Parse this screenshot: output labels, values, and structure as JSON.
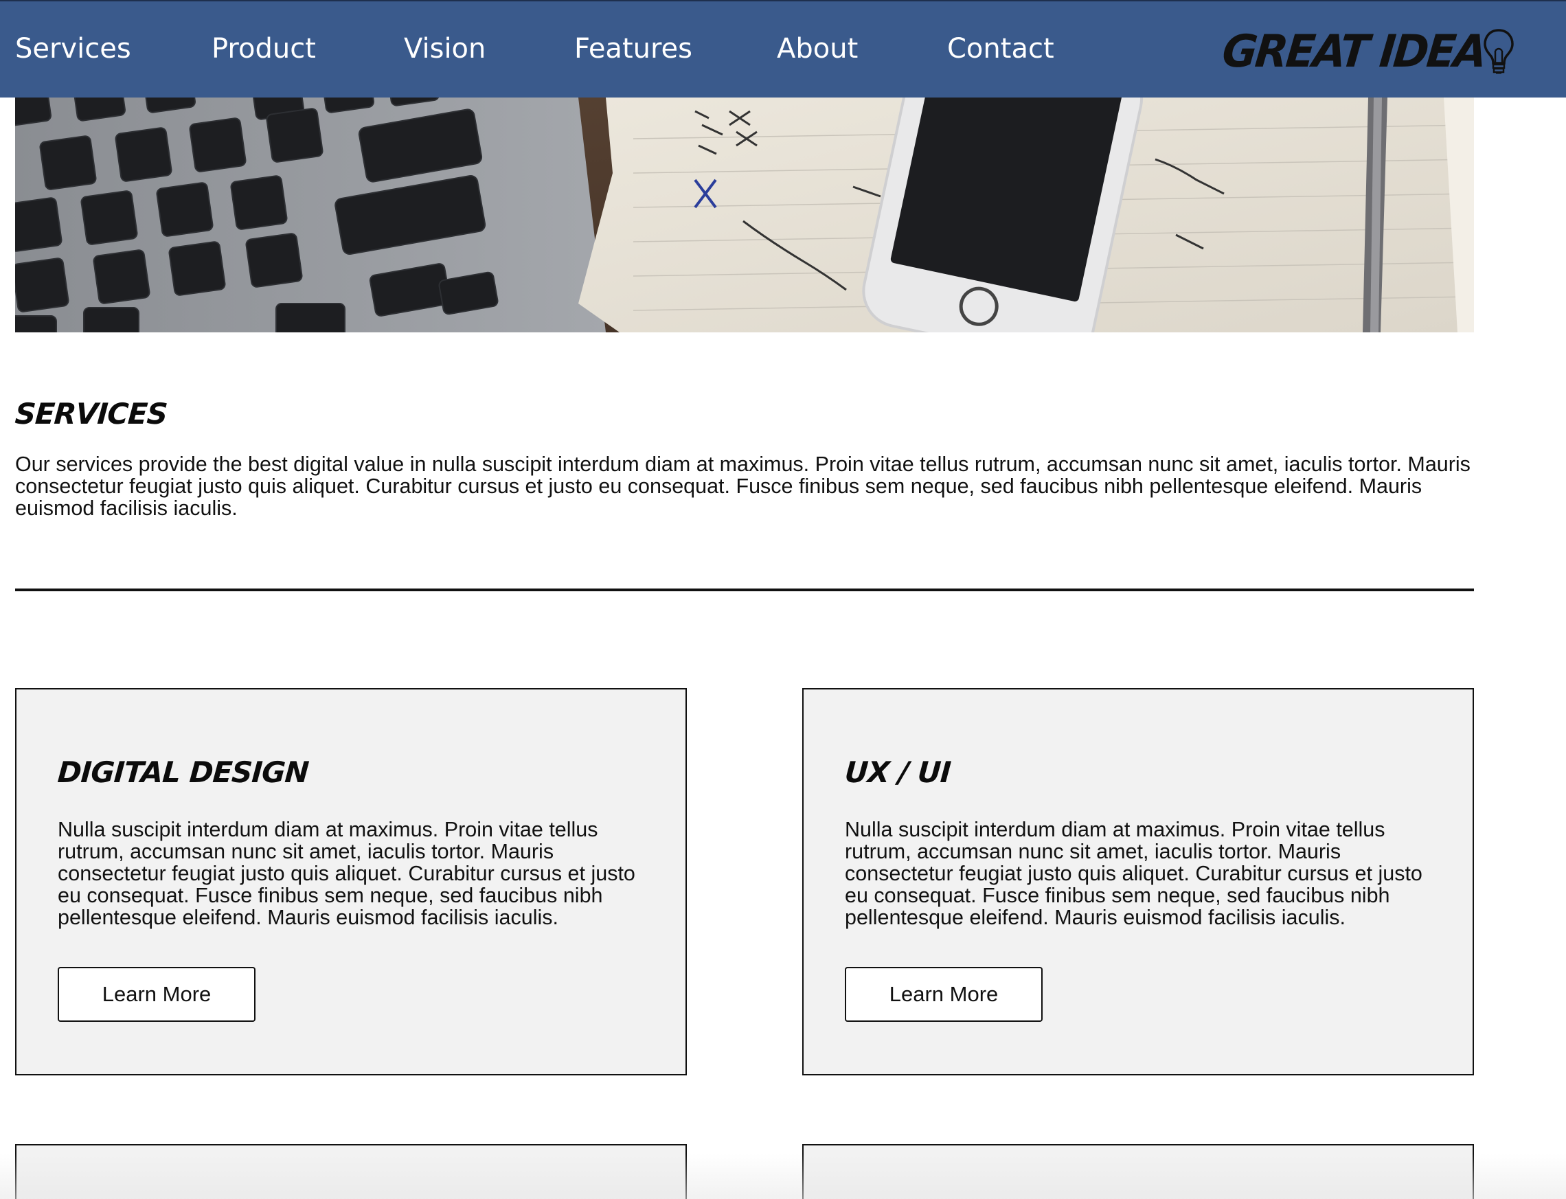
{
  "nav": {
    "items": [
      {
        "label": "Services"
      },
      {
        "label": "Product"
      },
      {
        "label": "Vision"
      },
      {
        "label": "Features"
      },
      {
        "label": "About"
      },
      {
        "label": "Contact"
      }
    ],
    "logo_text": "GREAT IDEA",
    "logo_icon": "lightbulb-icon",
    "background": "#3a5a8c"
  },
  "hero": {
    "image_subject": "laptop keyboard, notebook with handwritten notes, smartphone and pen on a wooden desk"
  },
  "services": {
    "title": "SERVICES",
    "text": "Our services provide the best digital value in nulla suscipit interdum diam at maximus. Proin vitae tellus rutrum, accumsan nunc sit amet, iaculis tortor. Mauris consectetur feugiat justo quis aliquet. Curabitur cursus et justo eu consequat. Fusce finibus sem neque, sed faucibus nibh pellentesque eleifend. Mauris euismod facilisis iaculis."
  },
  "cards": [
    {
      "title": "DIGITAL DESIGN",
      "text": "Nulla suscipit interdum diam at maximus. Proin vitae tellus rutrum, accumsan nunc sit amet, iaculis tortor. Mauris consectetur feugiat justo quis aliquet. Curabitur cursus et justo eu consequat. Fusce finibus sem neque, sed faucibus nibh pellentesque eleifend. Mauris euismod facilisis iaculis.",
      "button": "Learn More"
    },
    {
      "title": "UX / UI",
      "text": "Nulla suscipit interdum diam at maximus. Proin vitae tellus rutrum, accumsan nunc sit amet, iaculis tortor. Mauris consectetur feugiat justo quis aliquet. Curabitur cursus et justo eu consequat. Fusce finibus sem neque, sed faucibus nibh pellentesque eleifend. Mauris euismod facilisis iaculis.",
      "button": "Learn More"
    }
  ],
  "colors": {
    "nav_background": "#3a5a8c",
    "card_background": "#f2f2f2",
    "text": "#111111"
  }
}
